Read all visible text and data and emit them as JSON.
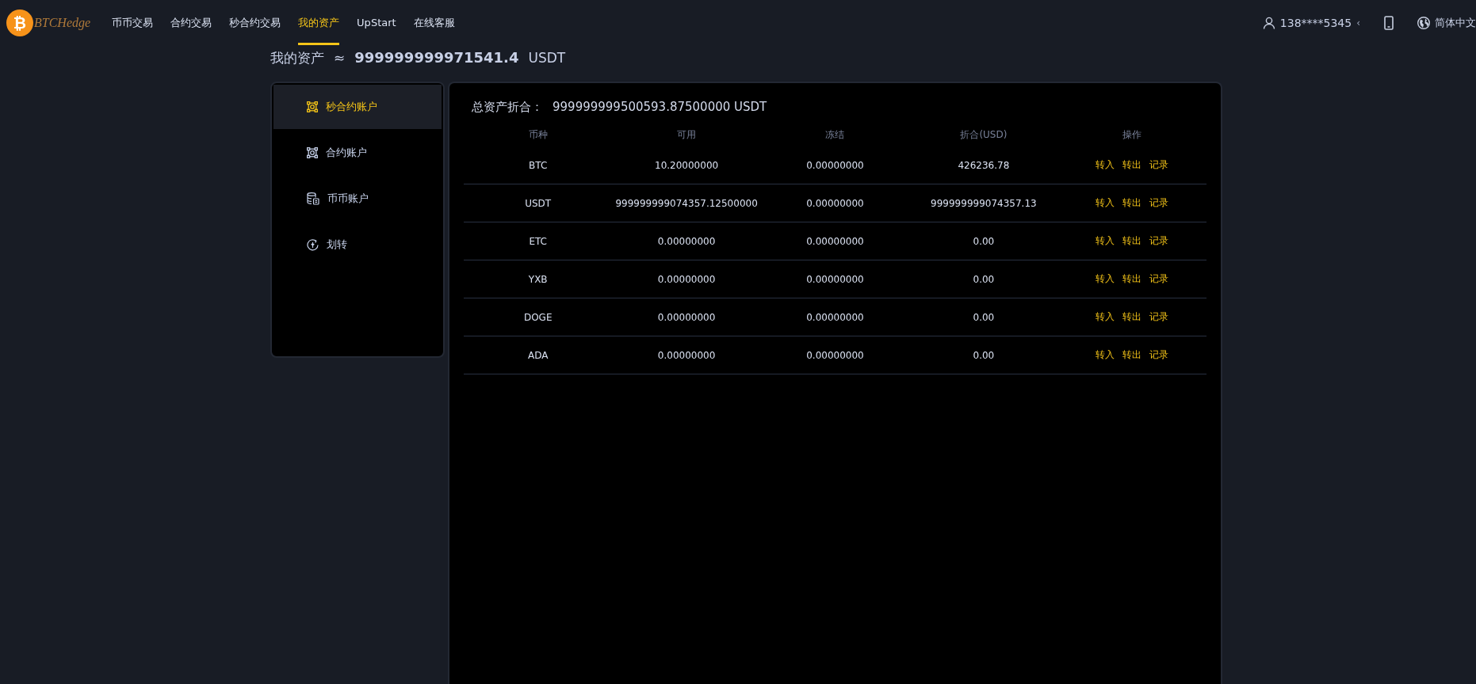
{
  "logo": {
    "symbol": "₿",
    "text": "BTCHedge"
  },
  "nav": [
    {
      "label": "币币交易",
      "selected": false
    },
    {
      "label": "合约交易",
      "selected": false
    },
    {
      "label": "秒合约交易",
      "selected": false
    },
    {
      "label": "我的资产",
      "selected": true
    },
    {
      "label": "UpStart",
      "selected": false
    },
    {
      "label": "在线客服",
      "selected": false
    }
  ],
  "user": {
    "phone": "138****5345",
    "caret": "‹",
    "language": "简体中文"
  },
  "page_title": {
    "label": "我的资产",
    "approx": "≈",
    "amount": "999999999971541.4",
    "unit": "USDT"
  },
  "sidebar": {
    "items": [
      {
        "label": "秒合约账户",
        "kind": "contract",
        "selected": true
      },
      {
        "label": "合约账户",
        "kind": "contract",
        "selected": false
      },
      {
        "label": "币币账户",
        "kind": "coins",
        "selected": false
      },
      {
        "label": "划转",
        "kind": "transfer",
        "selected": false
      }
    ]
  },
  "total": {
    "label": "总资产折合：",
    "value": "999999999500593.87500000 USDT"
  },
  "table": {
    "columns": [
      "币种",
      "可用",
      "冻结",
      "折合(USD)",
      "操作"
    ],
    "rows": [
      {
        "coin": "BTC",
        "available": "10.20000000",
        "frozen": "0.00000000",
        "usd": "426236.78",
        "actions": [
          "转入",
          "转出",
          "记录"
        ]
      },
      {
        "coin": "USDT",
        "available": "999999999074357.12500000",
        "frozen": "0.00000000",
        "usd": "999999999074357.13",
        "actions": [
          "转入",
          "转出",
          "记录"
        ]
      },
      {
        "coin": "ETC",
        "available": "0.00000000",
        "frozen": "0.00000000",
        "usd": "0.00",
        "actions": [
          "转入",
          "转出",
          "记录"
        ]
      },
      {
        "coin": "YXB",
        "available": "0.00000000",
        "frozen": "0.00000000",
        "usd": "0.00",
        "actions": [
          "转入",
          "转出",
          "记录"
        ]
      },
      {
        "coin": "DOGE",
        "available": "0.00000000",
        "frozen": "0.00000000",
        "usd": "0.00",
        "actions": [
          "转入",
          "转出",
          "记录"
        ]
      },
      {
        "coin": "ADA",
        "available": "0.00000000",
        "frozen": "0.00000000",
        "usd": "0.00",
        "actions": [
          "转入",
          "转出",
          "记录"
        ]
      }
    ]
  }
}
